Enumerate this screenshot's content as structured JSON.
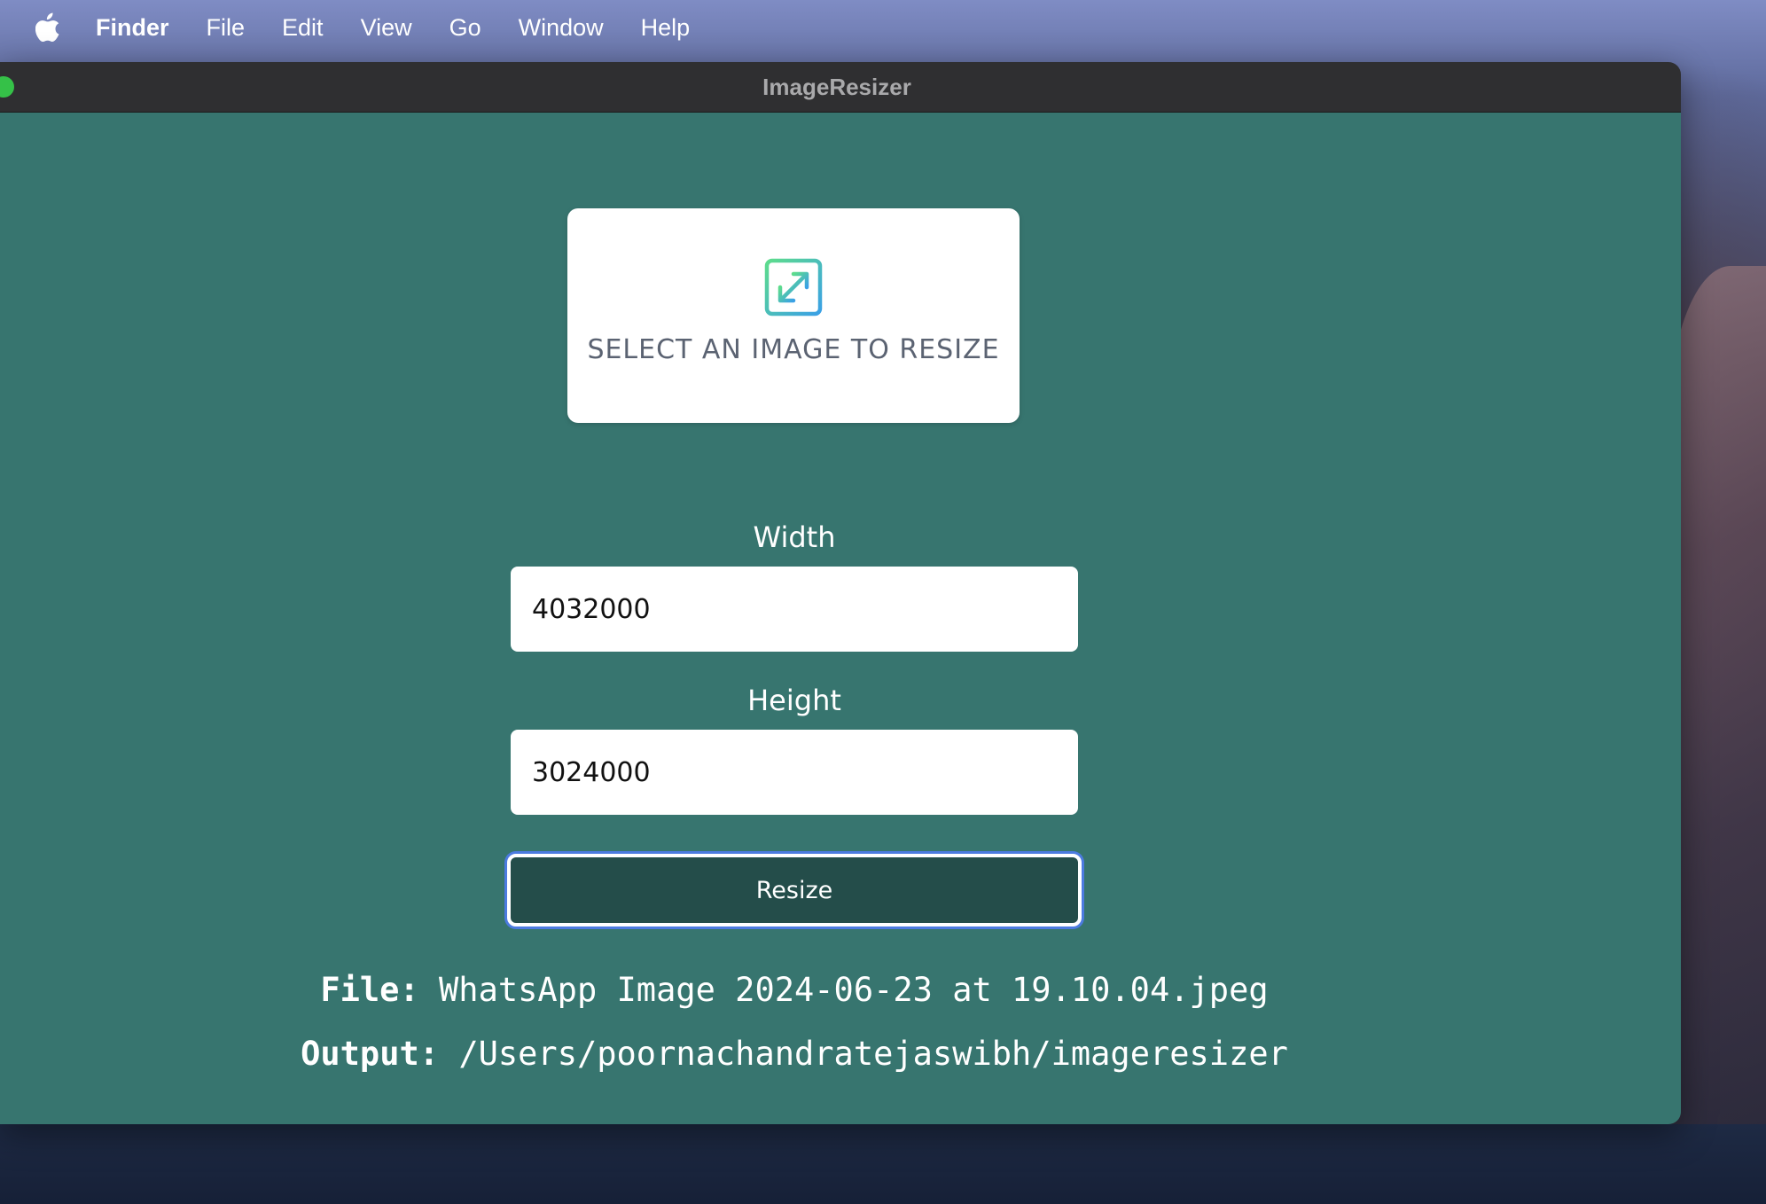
{
  "menubar": {
    "app_name": "Finder",
    "items": [
      "File",
      "Edit",
      "View",
      "Go",
      "Window",
      "Help"
    ]
  },
  "window": {
    "title": "ImageResizer"
  },
  "select_card": {
    "label": "SELECT AN IMAGE TO RESIZE",
    "icon": "expand-arrows-icon"
  },
  "width_field": {
    "label": "Width",
    "value": "4032000"
  },
  "height_field": {
    "label": "Height",
    "value": "3024000"
  },
  "resize_button": {
    "label": "Resize"
  },
  "file_info": {
    "file_label": "File:",
    "file_value": "WhatsApp Image 2024-06-23 at 19.10.04.jpeg",
    "output_label": "Output:",
    "output_value": "/Users/poornachandratejaswibh/imageresizer"
  },
  "colors": {
    "content_background": "#37756f",
    "button_background": "#244d4a",
    "focus_ring": "#4c7be0",
    "icon_gradient_start": "#5ddc8c",
    "icon_gradient_end": "#3aa0e6"
  }
}
